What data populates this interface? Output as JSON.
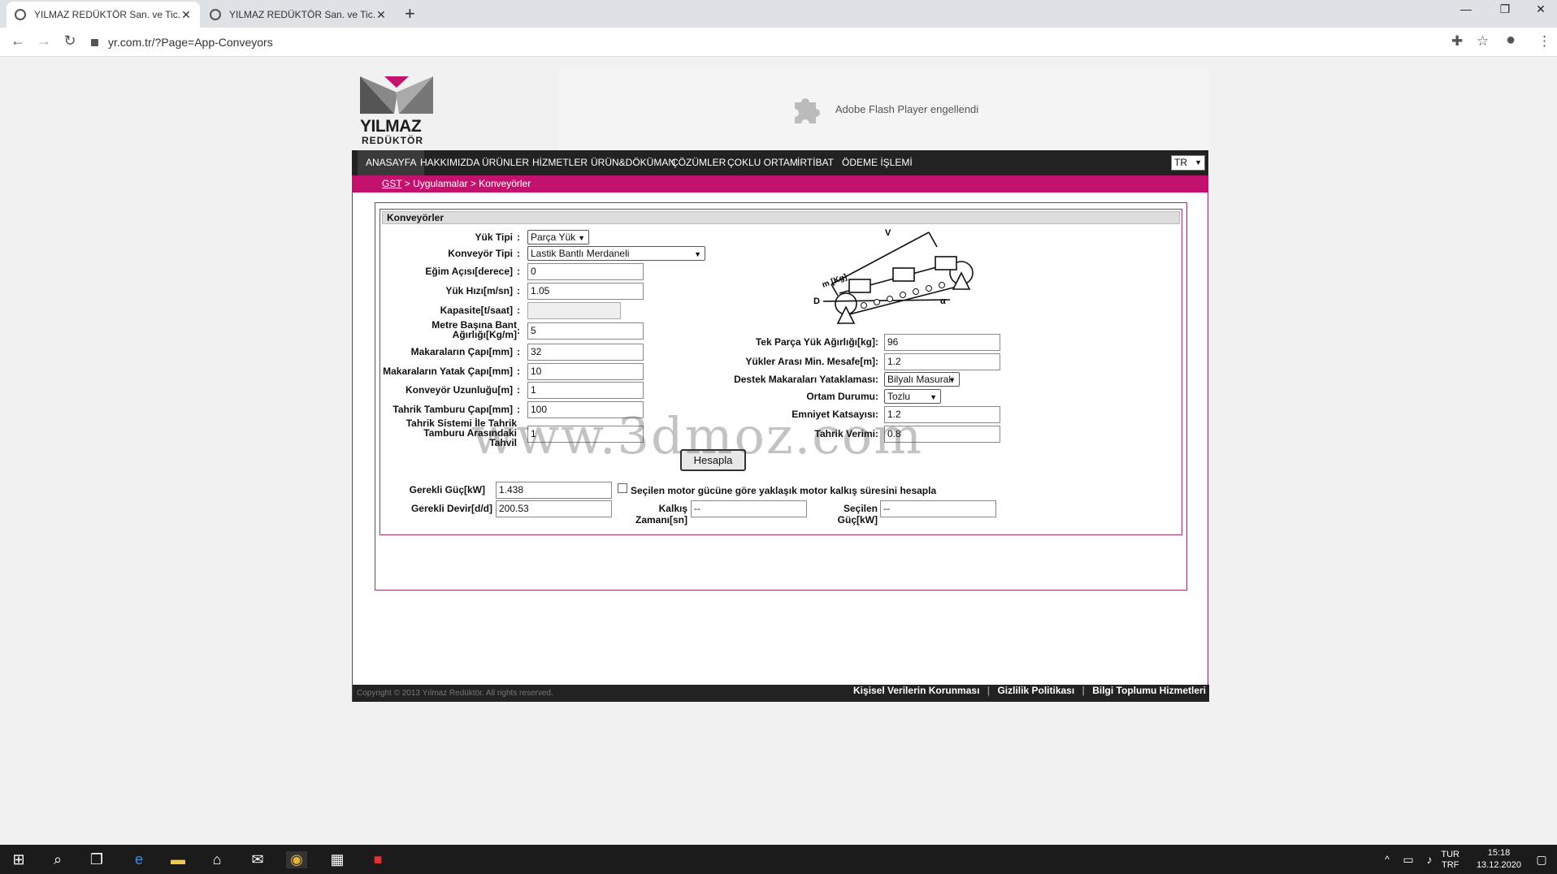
{
  "browser": {
    "tabs": [
      {
        "title": "YILMAZ REDÜKTÖR San. ve Tic. A"
      },
      {
        "title": "YILMAZ REDÜKTÖR San. ve Tic. A"
      }
    ],
    "url": "yr.com.tr/?Page=App-Conveyors"
  },
  "header": {
    "logo_line1": "YILMAZ",
    "logo_line2": "REDÜKTÖR",
    "flash_message": "Adobe Flash Player engellendi"
  },
  "menu": {
    "items": [
      "ANASAYFA",
      "HAKKIMIZDA",
      "ÜRÜNLER",
      "HİZMETLER",
      "ÜRÜN&DÖKÜMAN",
      "ÇÖZÜMLER",
      "ÇOKLU ORTAM",
      "İRTİBAT",
      "ÖDEME İŞLEMİ"
    ],
    "language": "TR"
  },
  "breadcrumb": {
    "root": "GST",
    "rest": " > Uygulamalar > Konveyörler"
  },
  "form": {
    "section_title": "Konveyörler",
    "left": [
      {
        "label": "Yük Tipi",
        "value": "Parça Yük"
      },
      {
        "label": "Konveyör Tipi",
        "value": "Lastik Bantlı Merdaneli"
      },
      {
        "label": "Eğim Açısı[derece]",
        "value": "0"
      },
      {
        "label": "Yük Hızı[m/sn]",
        "value": "1.05"
      },
      {
        "label": "Kapasite[t/saat]",
        "value": ""
      },
      {
        "label": "Metre Başına Bant Ağırlığı[Kg/m]",
        "value": "5"
      },
      {
        "label": "Makaraların Çapı[mm]",
        "value": "32"
      },
      {
        "label": "Makaraların Yatak Çapı[mm]",
        "value": "10"
      },
      {
        "label": "Konveyör Uzunluğu[m]",
        "value": "1"
      },
      {
        "label": "Tahrik Tamburu Çapı[mm]",
        "value": "100"
      },
      {
        "label": "Tahrik Sistemi İle Tahrik Tamburu Arasındaki Tahvil",
        "value": "1"
      }
    ],
    "right": [
      {
        "label": "Tek Parça Yük Ağırlığı[kg]",
        "value": "96"
      },
      {
        "label": "Yükler Arası Min. Mesafe[m]",
        "value": "1.2"
      },
      {
        "label": "Destek Makaraları Yataklaması",
        "value": "Bilyalı Masuralı"
      },
      {
        "label": "Ortam Durumu",
        "value": "Tozlu"
      },
      {
        "label": "Emniyet Katsayısı",
        "value": "1.2"
      },
      {
        "label": "Tahrik Verimi",
        "value": "0.8"
      }
    ],
    "calculate_label": "Hesapla",
    "diagram": {
      "v": "V",
      "m": "m [Kg]",
      "d": "D",
      "alpha": "α"
    }
  },
  "results": {
    "power_label": "Gerekli Güç[kW]",
    "power_value": "1.438",
    "checkbox_label": "Seçilen motor gücüne göre yaklaşık motor kalkış süresini hesapla",
    "rpm_label": "Gerekli Devir[d/d]",
    "rpm_value": "200.53",
    "start_time_label": "Kalkış Zamanı[sn]",
    "start_time_value": "--",
    "selected_power_label": "Seçilen Güç[kW]",
    "selected_power_value": "--"
  },
  "footer": {
    "copyright": "Copyright © 2013 Yılmaz Redüktör. All rights reserved.",
    "links": [
      "Kişisel Verilerin Korunması",
      "Gizlilik Politikası",
      "Bilgi Toplumu Hizmetleri"
    ]
  },
  "watermark": "www.3dmoz.com",
  "taskbar": {
    "lang1": "TUR",
    "lang2": "TRF",
    "time": "15:18",
    "date": "13.12.2020"
  },
  "colors": {
    "brand": "#c3126e",
    "menu_bg": "#222222"
  }
}
